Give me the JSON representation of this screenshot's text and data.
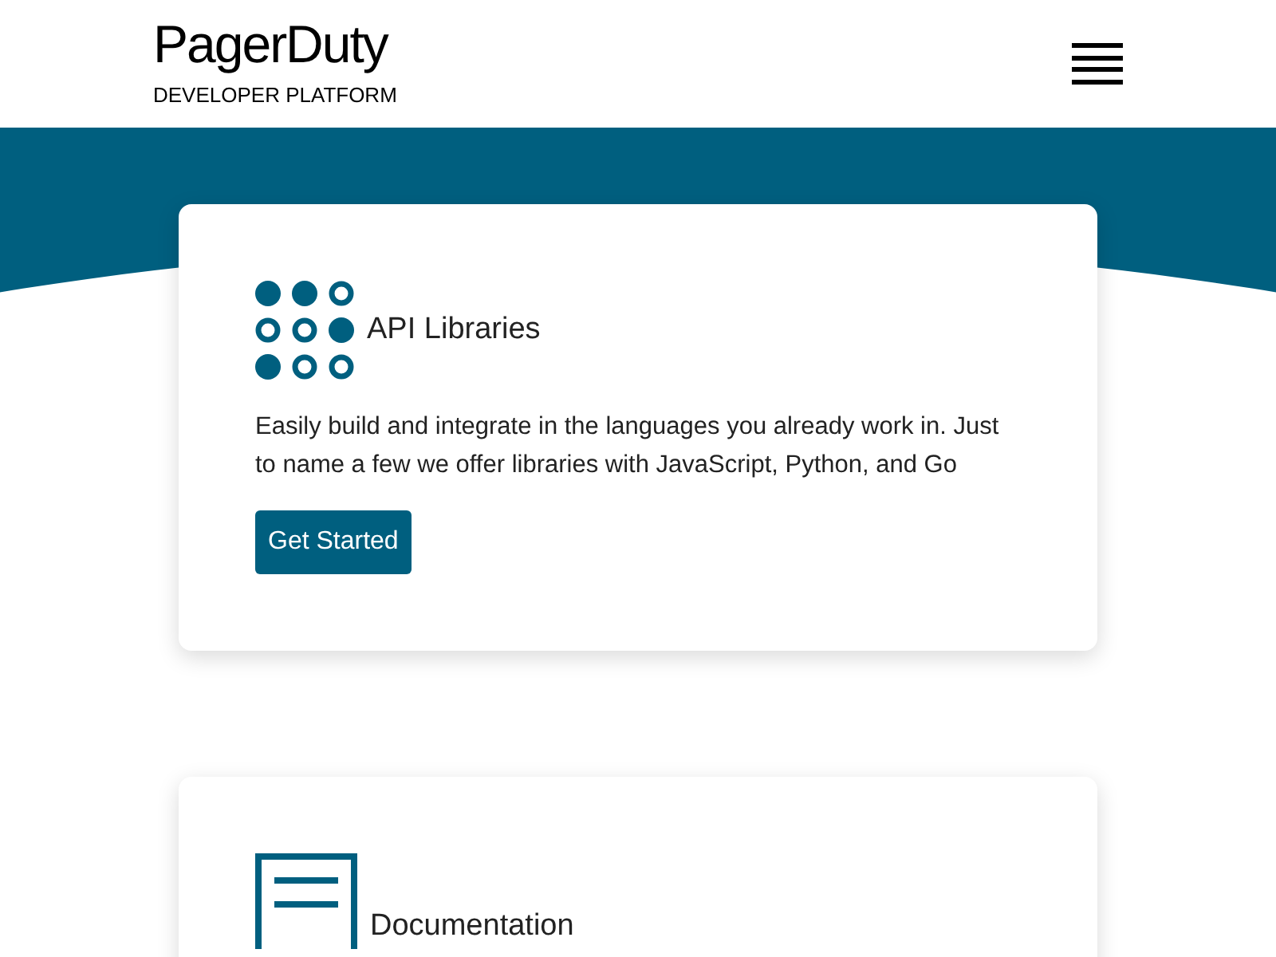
{
  "header": {
    "logo": "PagerDuty",
    "subtitle": "DEVELOPER PLATFORM"
  },
  "cards": [
    {
      "kind": "dots",
      "title": "API Libraries",
      "text": "Easily build and integrate in the languages you already work in. Just to name a few we offer libraries with JavaScript, Python, and Go",
      "button": "Get Started"
    },
    {
      "kind": "document",
      "title": "Documentation"
    }
  ]
}
